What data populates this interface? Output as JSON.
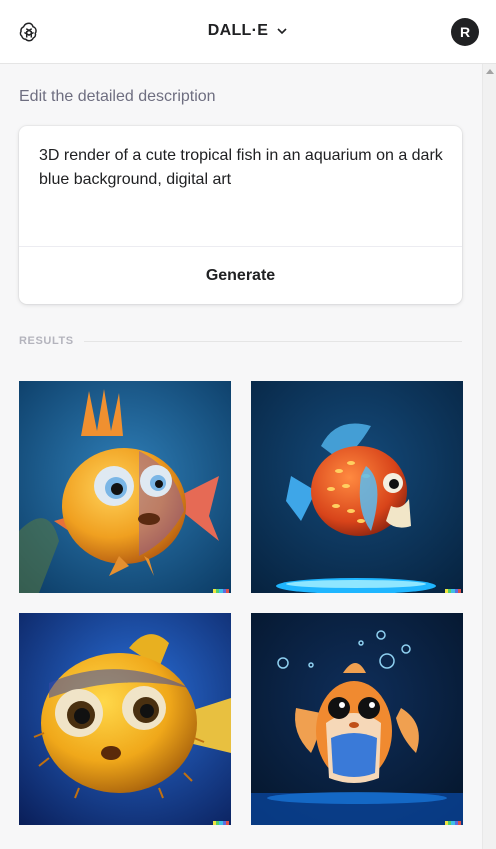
{
  "header": {
    "app_title": "DALL·E",
    "avatar_initial": "R",
    "logo_icon": "openai-logo-icon",
    "dropdown_icon": "chevron-down-icon"
  },
  "editor": {
    "label": "Edit the detailed description",
    "prompt": "3D render of a cute tropical fish in an aquarium on a dark blue background, digital art",
    "generate_label": "Generate"
  },
  "results": {
    "label": "RESULTS",
    "images": [
      {
        "subject": "orange fish with spiky fin on teal blue background"
      },
      {
        "subject": "spotted orange pufferfish above glowing blue platform"
      },
      {
        "subject": "yellow spiky pufferfish with big eyes on blue background"
      },
      {
        "subject": "orange and blue fish with bubbles on dark blue background"
      }
    ],
    "watermark_colors": [
      "#f0e442",
      "#56d06b",
      "#3fbfe8",
      "#5b6ee0",
      "#e0504a"
    ]
  },
  "colors": {
    "background": "#f7f7f8",
    "text": "#202123",
    "muted_text": "#6e6e80"
  }
}
